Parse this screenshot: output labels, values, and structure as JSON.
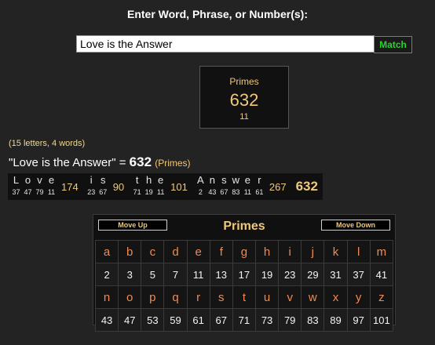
{
  "form": {
    "heading": "Enter Word, Phrase, or Number(s):",
    "input_value": "Love is the Answer",
    "match_label": "Match"
  },
  "result": {
    "cipher": "Primes",
    "value": "632",
    "count": "11"
  },
  "summary": {
    "counts": "(15 letters, 4 words)",
    "phrase": "\"Love is the Answer\"",
    "equals": " = ",
    "total": "632",
    "cipher": "(Primes)"
  },
  "breakdown": {
    "words": [
      {
        "letters": [
          {
            "ch": "L",
            "val": "37"
          },
          {
            "ch": "o",
            "val": "47"
          },
          {
            "ch": "v",
            "val": "79"
          },
          {
            "ch": "e",
            "val": "11"
          }
        ],
        "sum": "174"
      },
      {
        "letters": [
          {
            "ch": "i",
            "val": "23"
          },
          {
            "ch": "s",
            "val": "67"
          }
        ],
        "sum": "90"
      },
      {
        "letters": [
          {
            "ch": "t",
            "val": "71"
          },
          {
            "ch": "h",
            "val": "19"
          },
          {
            "ch": "e",
            "val": "11"
          }
        ],
        "sum": "101"
      },
      {
        "letters": [
          {
            "ch": "A",
            "val": "2"
          },
          {
            "ch": "n",
            "val": "43"
          },
          {
            "ch": "s",
            "val": "67"
          },
          {
            "ch": "w",
            "val": "83"
          },
          {
            "ch": "e",
            "val": "11"
          },
          {
            "ch": "r",
            "val": "61"
          }
        ],
        "sum": "267"
      }
    ],
    "grand_total": "632"
  },
  "cipher_table": {
    "title": "Primes",
    "move_up": "Move Up",
    "move_down": "Move Down",
    "rows": [
      {
        "letters": [
          "a",
          "b",
          "c",
          "d",
          "e",
          "f",
          "g",
          "h",
          "i",
          "j",
          "k",
          "l",
          "m"
        ],
        "values": [
          "2",
          "3",
          "5",
          "7",
          "11",
          "13",
          "17",
          "19",
          "23",
          "29",
          "31",
          "37",
          "41"
        ]
      },
      {
        "letters": [
          "n",
          "o",
          "p",
          "q",
          "r",
          "s",
          "t",
          "u",
          "v",
          "w",
          "x",
          "y",
          "z"
        ],
        "values": [
          "43",
          "47",
          "53",
          "59",
          "61",
          "67",
          "71",
          "73",
          "79",
          "83",
          "89",
          "97",
          "101"
        ]
      }
    ]
  }
}
